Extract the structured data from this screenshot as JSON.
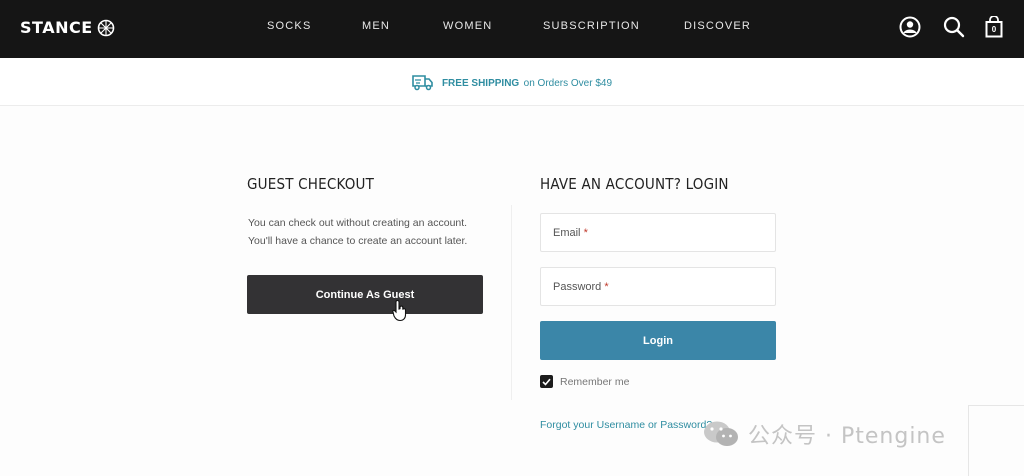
{
  "header": {
    "logo_text": "STANCE",
    "nav": [
      "SOCKS",
      "MEN",
      "WOMEN",
      "SUBSCRIPTION",
      "DISCOVER"
    ],
    "icons": [
      "account-icon",
      "search-icon",
      "cart-icon"
    ],
    "cart_count": "0"
  },
  "promo": {
    "icon": "delivery-truck-icon",
    "bold": "FREE SHIPPING",
    "rest": "on Orders Over $49"
  },
  "guest": {
    "title": "GUEST CHECKOUT",
    "line1": "You can check out without creating an account.",
    "line2": "You'll have a chance to create an account later.",
    "button": "Continue As Guest"
  },
  "login": {
    "title": "HAVE AN ACCOUNT? LOGIN",
    "email_label": "Email",
    "password_label": "Password",
    "required_mark": "*",
    "button": "Login",
    "remember": "Remember me",
    "forgot": "Forgot your Username or Password?"
  },
  "watermark": {
    "text": "公众号 · Ptengine"
  },
  "colors": {
    "nav_bg": "#151515",
    "accent": "#2f8da1",
    "login_button": "#3b86a8",
    "guest_button": "#333234"
  }
}
